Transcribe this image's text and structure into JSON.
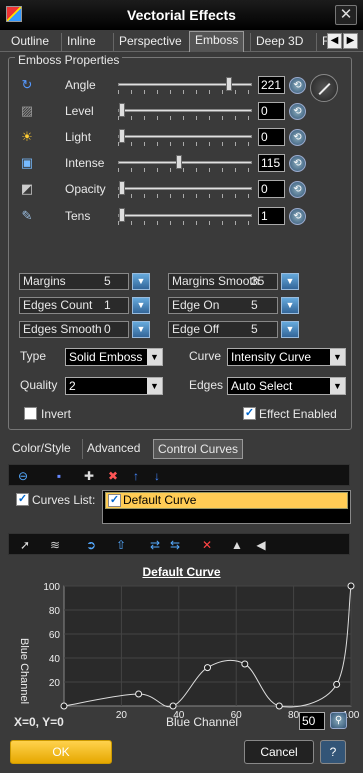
{
  "window": {
    "title": "Vectorial Effects",
    "close": "✕"
  },
  "tabs": [
    {
      "label": "Outline"
    },
    {
      "label": "Inline"
    },
    {
      "label": "Perspective"
    },
    {
      "label": "Emboss"
    },
    {
      "label": "Deep 3D"
    },
    {
      "label": "F"
    }
  ],
  "group_title": "Emboss Properties",
  "properties": [
    {
      "label": "Angle",
      "value": "221",
      "fraction": 0.85,
      "icon": "rotate-icon"
    },
    {
      "label": "Level",
      "value": "0",
      "fraction": 0.0,
      "icon": "level-icon"
    },
    {
      "label": "Light",
      "value": "0",
      "fraction": 0.0,
      "icon": "sun-icon"
    },
    {
      "label": "Intense",
      "value": "115",
      "fraction": 0.45,
      "icon": "intense-icon"
    },
    {
      "label": "Opacity",
      "value": "0",
      "fraction": 0.0,
      "icon": "opacity-icon"
    },
    {
      "label": "Tens",
      "value": "1",
      "fraction": 0.0,
      "icon": "tension-icon"
    }
  ],
  "spinners": {
    "margins": {
      "label": "Margins",
      "value": "5"
    },
    "margins_smooth": {
      "label": "Margins Smooth",
      "value": "35"
    },
    "edges_count": {
      "label": "Edges Count",
      "value": "1"
    },
    "edge_on": {
      "label": "Edge On",
      "value": "5"
    },
    "edges_smooth": {
      "label": "Edges Smooth",
      "value": "0"
    },
    "edge_off": {
      "label": "Edge Off",
      "value": "5"
    }
  },
  "combos": {
    "type": {
      "label": "Type",
      "value": "Solid Emboss"
    },
    "curve": {
      "label": "Curve",
      "value": "Intensity Curve"
    },
    "quality": {
      "label": "Quality",
      "value": "2"
    },
    "edges": {
      "label": "Edges",
      "value": "Auto Select"
    }
  },
  "invert": {
    "label": "Invert",
    "checked": false
  },
  "effect_enabled": {
    "label": "Effect Enabled",
    "checked": true
  },
  "subtabs": [
    {
      "label": "Color/Style"
    },
    {
      "label": "Advanced"
    },
    {
      "label": "Control Curves"
    }
  ],
  "curves_list": {
    "label": "Curves List:",
    "checked": true,
    "items": [
      "Default Curve"
    ]
  },
  "chart_data": {
    "type": "line",
    "title": "Default Curve",
    "xlabel": "Blue Channel",
    "ylabel": "Blue Channel",
    "xlim": [
      0,
      100
    ],
    "ylim": [
      0,
      100
    ],
    "xticks": [
      20,
      40,
      60,
      80,
      100
    ],
    "yticks": [
      20,
      40,
      60,
      80,
      100
    ],
    "control_points": [
      [
        0,
        0
      ],
      [
        26,
        10
      ],
      [
        38,
        0
      ],
      [
        50,
        32
      ],
      [
        63,
        35
      ],
      [
        75,
        0
      ],
      [
        95,
        18
      ],
      [
        100,
        100
      ]
    ]
  },
  "coords": "X=0, Y=0",
  "zoom_value": "50",
  "ok_label": "OK",
  "cancel_label": "Cancel",
  "help_label": "?"
}
